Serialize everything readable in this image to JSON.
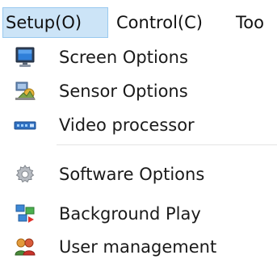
{
  "menubar": {
    "items": [
      {
        "label": "Setup(O)"
      },
      {
        "label": "Control(C)"
      },
      {
        "label": "Too"
      }
    ]
  },
  "dropdown": {
    "items": [
      {
        "label": "Screen Options",
        "icon": "monitor-icon"
      },
      {
        "label": "Sensor Options",
        "icon": "sensor-icon"
      },
      {
        "label": "Video processor",
        "icon": "video-processor-icon"
      },
      {
        "label": "Software Options",
        "icon": "software-gear-icon"
      },
      {
        "label": "Background Play",
        "icon": "background-play-icon"
      },
      {
        "label": "User management",
        "icon": "users-icon"
      }
    ]
  },
  "colors": {
    "active_menu_bg": "#cce4f7",
    "active_menu_border": "#99c9ef",
    "text": "#1a1a1a"
  }
}
